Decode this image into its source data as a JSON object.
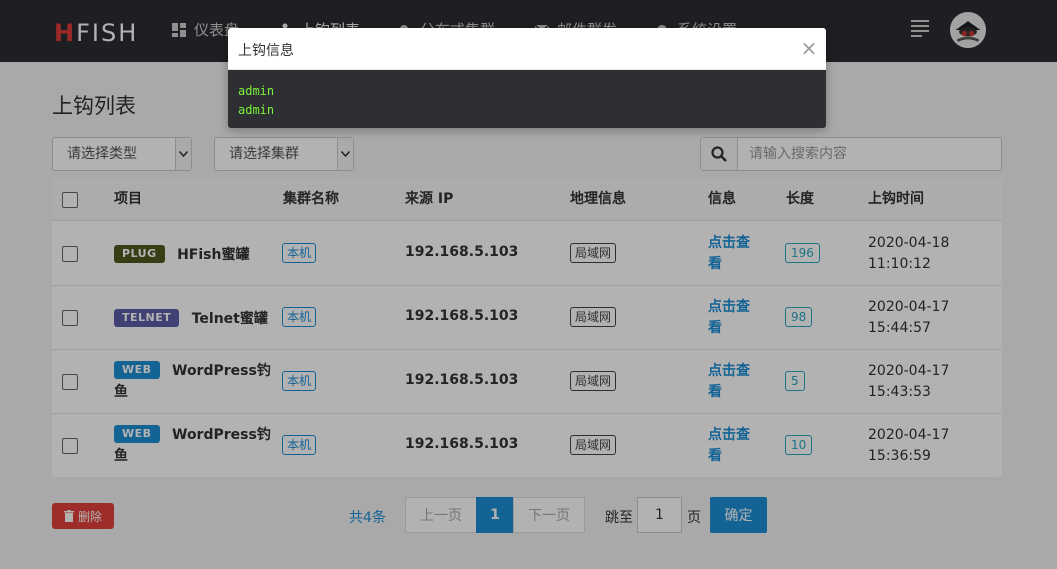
{
  "app": {
    "logo_first": "H",
    "logo_rest": "FISH"
  },
  "nav": {
    "items": [
      {
        "label": "仪表盘",
        "icon": "dashboard-icon"
      },
      {
        "label": "上钩列表",
        "icon": "fishhook-icon"
      },
      {
        "label": "分布式集群",
        "icon": "cloud-icon"
      },
      {
        "label": "邮件群发",
        "icon": "mail-icon"
      },
      {
        "label": "系统设置",
        "icon": "gear-icon"
      }
    ],
    "menu_icon": "menu-lines-icon",
    "avatar_icon": "avatar-icon"
  },
  "page": {
    "title": "上钩列表"
  },
  "filters": {
    "type_select": "请选择类型",
    "cluster_select": "请选择集群",
    "search_placeholder": "请输入搜索内容"
  },
  "table": {
    "headers": {
      "project": "项目",
      "cluster": "集群名称",
      "source_ip": "来源 IP",
      "geo": "地理信息",
      "info": "信息",
      "length": "长度",
      "time": "上钩时间"
    },
    "rows": [
      {
        "tag": "PLUG",
        "tag_color": "#4d5a1e",
        "name": "HFish蜜罐",
        "cluster": "本机",
        "ip": "192.168.5.103",
        "geo": "局域网",
        "info_line1": "点击查",
        "info_line2": "看",
        "length": "196",
        "date": "2020-04-18",
        "clock": "11:10:12"
      },
      {
        "tag": "TELNET",
        "tag_color": "#5b5ea6",
        "name": "Telnet蜜罐",
        "cluster": "本机",
        "ip": "192.168.5.103",
        "geo": "局域网",
        "info_line1": "点击查",
        "info_line2": "看",
        "length": "98",
        "date": "2020-04-17",
        "clock": "15:44:57"
      },
      {
        "tag": "WEB",
        "tag_color": "#1e8fd6",
        "name": "WordPress钓",
        "name2": "鱼",
        "cluster": "本机",
        "ip": "192.168.5.103",
        "geo": "局域网",
        "info_line1": "点击查",
        "info_line2": "看",
        "length": "5",
        "date": "2020-04-17",
        "clock": "15:43:53"
      },
      {
        "tag": "WEB",
        "tag_color": "#1e8fd6",
        "name": "WordPress钓",
        "name2": "鱼",
        "cluster": "本机",
        "ip": "192.168.5.103",
        "geo": "局域网",
        "info_line1": "点击查",
        "info_line2": "看",
        "length": "10",
        "date": "2020-04-17",
        "clock": "15:36:59"
      }
    ]
  },
  "footer": {
    "delete_label": "删除",
    "total": "共4条",
    "prev": "上一页",
    "current_page": "1",
    "next": "下一页",
    "jump_to": "跳至",
    "jump_value": "1",
    "page_unit": "页",
    "confirm": "确定"
  },
  "modal": {
    "title": "上钩信息",
    "close": "×",
    "lines": [
      "admin",
      "admin"
    ]
  }
}
